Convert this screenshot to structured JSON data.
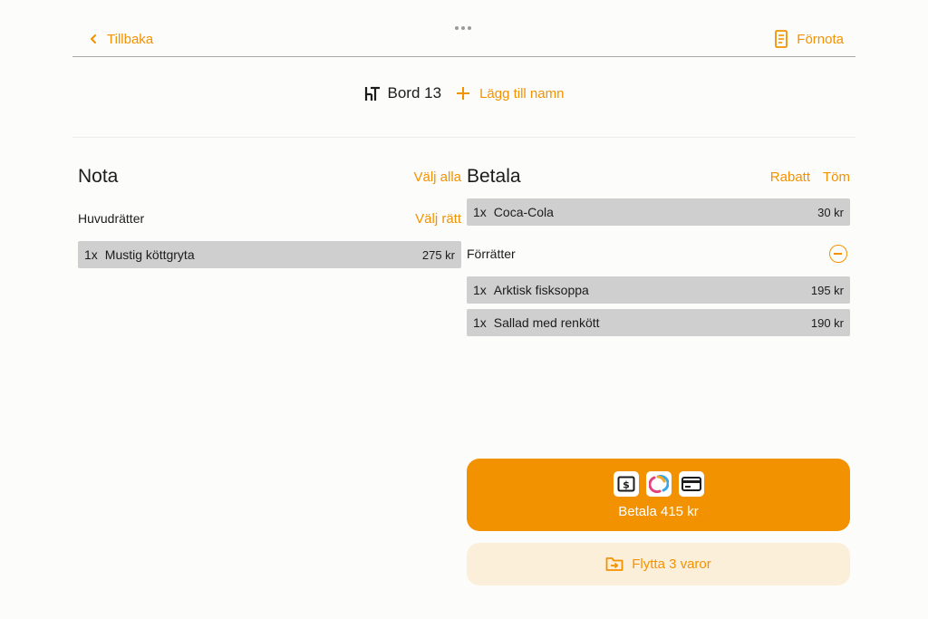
{
  "nav": {
    "back_label": "Tillbaka",
    "back_icon": "chevron-left-icon",
    "prebill_label": "Förnota",
    "prebill_icon": "receipt-icon"
  },
  "table": {
    "icon": "table-icon",
    "name": "Bord 13",
    "add_name_label": "Lägg till namn"
  },
  "bill": {
    "title": "Nota",
    "select_all_label": "Välj alla",
    "groups": [
      {
        "title": "Huvudrätter",
        "action_label": "Välj rätt",
        "items": [
          {
            "qty": "1x",
            "name": "Mustig köttgryta",
            "price": "275 kr"
          }
        ]
      }
    ]
  },
  "pay": {
    "title": "Betala",
    "discount_label": "Rabatt",
    "clear_label": "Töm",
    "ungrouped_items": [
      {
        "qty": "1x",
        "name": "Coca-Cola",
        "price": "30 kr"
      }
    ],
    "groups": [
      {
        "title": "Förrätter",
        "items": [
          {
            "qty": "1x",
            "name": "Arktisk fisksoppa",
            "price": "195 kr"
          },
          {
            "qty": "1x",
            "name": "Sallad med renkött",
            "price": "190 kr"
          }
        ]
      }
    ],
    "pay_button_label": "Betala 415 kr",
    "payment_icons": [
      "cash-icon",
      "swish-icon",
      "card-icon"
    ],
    "move_button_label": "Flytta 3 varor",
    "move_icon": "folder-move-icon"
  },
  "colors": {
    "accent": "#f39200",
    "accent_light": "#fcefd9",
    "row_bg": "#cfcfcf",
    "background": "#fcfcfa"
  }
}
